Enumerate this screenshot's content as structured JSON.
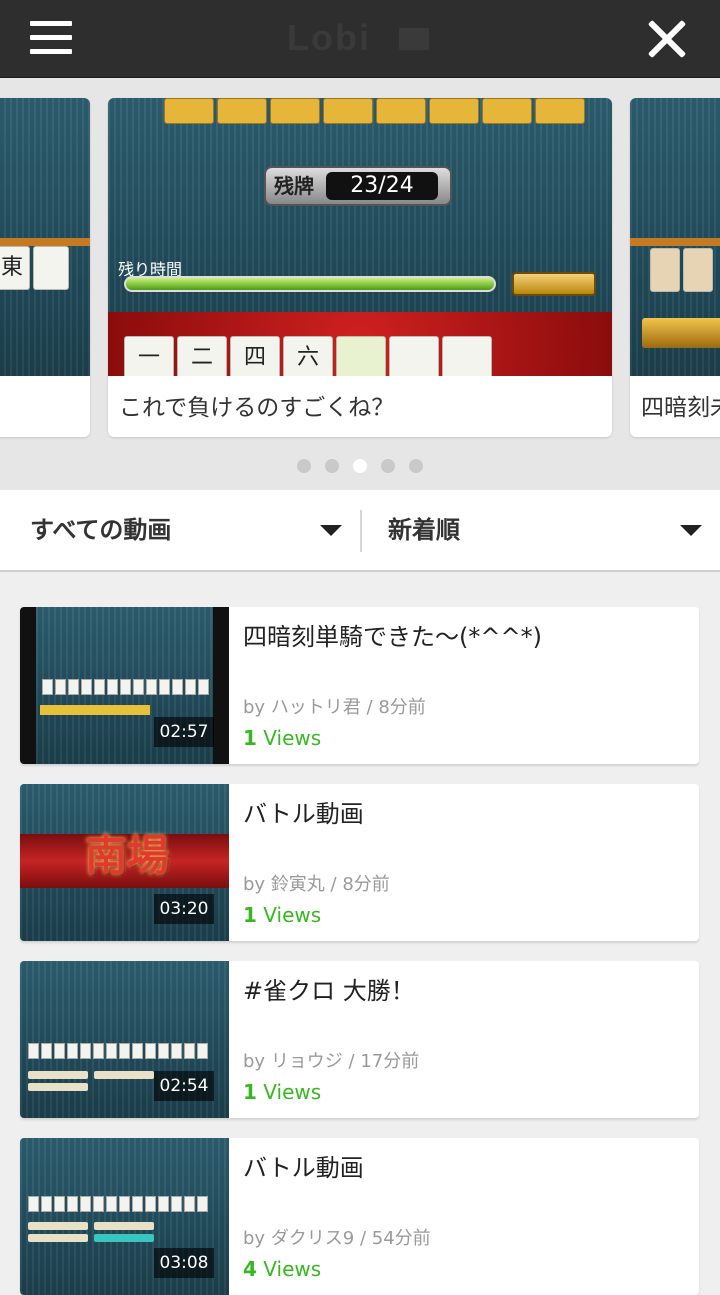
{
  "header": {
    "logo_text": "Lobi",
    "menu_icon": "hamburger-menu-icon",
    "close_icon": "close-icon"
  },
  "carousel": {
    "slides": [
      {
        "caption": ""
      },
      {
        "caption": "これで負けるのすごくね？",
        "count_label": "残牌",
        "count_value": "23/24",
        "timer_label": "残り時間",
        "tiles": [
          "一",
          "二",
          "四",
          "六",
          "",
          "",
          ""
        ]
      },
      {
        "caption": "四暗刻未"
      }
    ],
    "left_slide_tiles": [
      "東"
    ],
    "page_count": 5,
    "active_index": 2
  },
  "filters": {
    "category": "すべての動画",
    "sort": "新着順"
  },
  "videos": [
    {
      "title": "四暗刻単騎できた〜(*^^*)",
      "author": "ハットリ君",
      "time_ago": "8分前",
      "views_count": "1",
      "views_label": "Views",
      "duration": "02:57"
    },
    {
      "title": "バトル動画",
      "author": "鈴寅丸",
      "time_ago": "8分前",
      "views_count": "1",
      "views_label": "Views",
      "duration": "03:20",
      "emblem": "南場"
    },
    {
      "title": "#雀クロ 大勝！",
      "author": "リョウジ",
      "time_ago": "17分前",
      "views_count": "1",
      "views_label": "Views",
      "duration": "02:54"
    },
    {
      "title": "バトル動画",
      "author": "ダクリス9",
      "time_ago": "54分前",
      "views_count": "4",
      "views_label": "Views",
      "duration": "03:08"
    }
  ],
  "colors": {
    "header_bg": "#2e2e2e",
    "views_green": "#38b820",
    "page_bg": "#efefef"
  }
}
